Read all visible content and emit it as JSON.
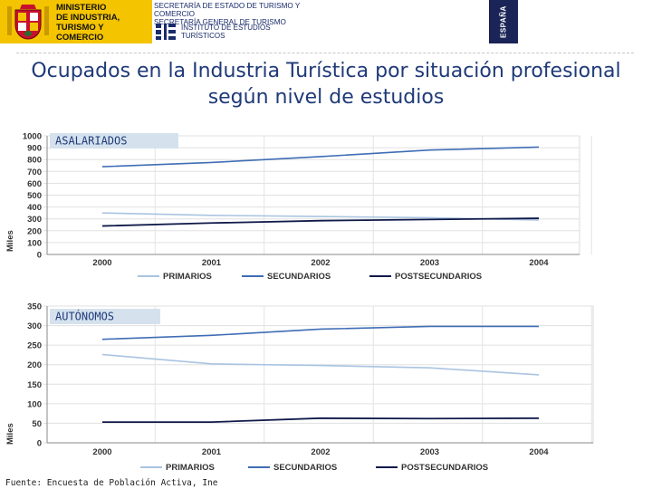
{
  "header": {
    "ministry": "MINISTERIO\nDE INDUSTRIA,\nTURISMO Y\nCOMERCIO",
    "secretaria": "SECRETARÍA DE ESTADO DE TURISMO Y COMERCIO\nSECRETARÍA GENERAL DE TURISMO",
    "instituto": "INSTITUTO DE ESTUDIOS\nTURÍSTICOS",
    "espana": "ESPAÑA",
    "colors": {
      "ministry_bg": "#f4c400",
      "navy": "#1a2456"
    },
    "icons": [
      "coat-of-arms-icon",
      "instituto-logo-icon"
    ]
  },
  "title": "Ocupados en la Industria Turística por situación profesional según nivel de estudios",
  "source": "Fuente: Encuesta de Población Activa, Ine",
  "chart_data": [
    {
      "type": "line",
      "label": "ASALARIADOS",
      "ylabel": "Miles",
      "ylim": [
        0,
        1000
      ],
      "yticks": [
        0,
        100,
        200,
        300,
        400,
        500,
        600,
        700,
        800,
        900,
        1000
      ],
      "categories": [
        "2000",
        "2001",
        "2002",
        "2003",
        "2004"
      ],
      "series": [
        {
          "name": "PRIMARIOS",
          "color": "#a9c4e0",
          "values": [
            350,
            330,
            320,
            310,
            290
          ]
        },
        {
          "name": "SECUNDARIOS",
          "color": "#3f6db5",
          "values": [
            740,
            775,
            825,
            880,
            905
          ]
        },
        {
          "name": "POSTSECUNDARIOS",
          "color": "#101a4a",
          "values": [
            240,
            265,
            285,
            295,
            305
          ]
        }
      ],
      "legend": "bottom",
      "grid": true
    },
    {
      "type": "line",
      "label": "AUTÓNOMOS",
      "ylabel": "Miles",
      "ylim": [
        0,
        350
      ],
      "yticks": [
        0,
        50,
        100,
        150,
        200,
        250,
        300,
        350
      ],
      "categories": [
        "2000",
        "2001",
        "2002",
        "2003",
        "2004"
      ],
      "series": [
        {
          "name": "PRIMARIOS",
          "color": "#a9c4e0",
          "values": [
            226,
            202,
            198,
            192,
            174
          ]
        },
        {
          "name": "SECUNDARIOS",
          "color": "#3f6db5",
          "values": [
            265,
            275,
            291,
            298,
            298
          ]
        },
        {
          "name": "POSTSECUNDARIOS",
          "color": "#101a4a",
          "values": [
            53,
            53,
            63,
            62,
            63
          ]
        }
      ],
      "legend": "bottom",
      "grid": true
    }
  ]
}
